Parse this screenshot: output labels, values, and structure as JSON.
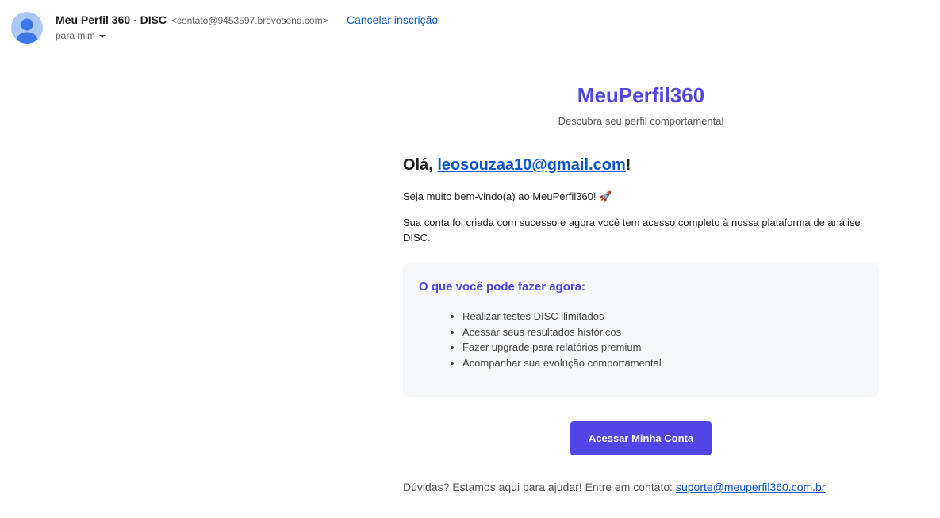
{
  "header": {
    "sender_name": "Meu Perfil 360 - DISC",
    "sender_email": "<contato@9453597.brevosend.com>",
    "unsubscribe_label": "Cancelar inscrição",
    "to_label": "para mim",
    "avatar_icon": "person-icon",
    "caret_icon": "chevron-down-icon"
  },
  "email": {
    "brand": "MeuPerfil360",
    "tagline": "Descubra seu perfil comportamental",
    "greeting_prefix": "Olá, ",
    "greeting_email": "leosouzaa10@gmail.com",
    "greeting_suffix": "!",
    "welcome": "Seja muito bem-vindo(a) ao MeuPerfil360! 🚀",
    "intro": "Sua conta foi criada com sucesso e agora você tem acesso completo à nossa plataforma de análise DISC.",
    "features_title": "O que você pode fazer agora:",
    "features": [
      "Realizar testes DISC ilimitados",
      "Acessar seus resultados históricos",
      "Fazer upgrade para relatórios premium",
      "Acompanhar sua evolução comportamental"
    ],
    "cta_label": "Acessar Minha Conta",
    "footer_text": "Dúvidas? Estamos aqui para ajudar! Entre em contato: ",
    "footer_email": "suporte@meuperfil360.com.br"
  },
  "colors": {
    "brand": "#4f46e5",
    "link": "#0b57d0",
    "avatar_bg": "#aac7f5",
    "avatar_fg": "#3b78e7"
  }
}
